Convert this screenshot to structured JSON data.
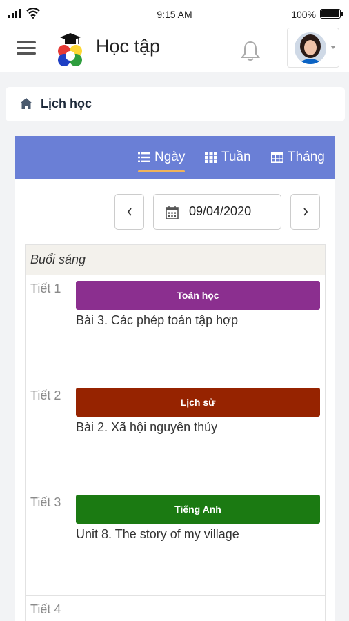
{
  "status_bar": {
    "time": "9:15 AM",
    "battery": "100%"
  },
  "header": {
    "title": "Học tập",
    "menu_icon": "hamburger-icon",
    "logo_icon": "graduation-cap-logo",
    "notification_icon": "bell-icon"
  },
  "breadcrumb": {
    "icon": "home-icon",
    "label": "Lịch học"
  },
  "tabs": [
    {
      "label": "Ngày",
      "icon": "list-icon",
      "active": true
    },
    {
      "label": "Tuần",
      "icon": "grid-icon",
      "active": false
    },
    {
      "label": "Tháng",
      "icon": "table-icon",
      "active": false
    }
  ],
  "date_picker": {
    "value": "09/04/2020",
    "prev": "‹",
    "next": "›"
  },
  "colors": {
    "tabbar": "#6a7fd6",
    "tab_underline": "#f0b35a",
    "subject_math": "#8b2f8f",
    "subject_history": "#962300",
    "subject_english": "#1b7a12"
  },
  "schedule": {
    "session_label": "Buổi sáng",
    "periods": [
      {
        "label": "Tiết 1",
        "subject": "Toán học",
        "lesson": "Bài 3. Các phép toán tập hợp",
        "color": "#8b2f8f"
      },
      {
        "label": "Tiết 2",
        "subject": "Lịch sử",
        "lesson": "Bài 2. Xã hội nguyên thủy",
        "color": "#962300"
      },
      {
        "label": "Tiết 3",
        "subject": "Tiếng Anh",
        "lesson": "Unit 8. The story of my village",
        "color": "#1b7a12"
      },
      {
        "label": "Tiết 4"
      }
    ]
  }
}
